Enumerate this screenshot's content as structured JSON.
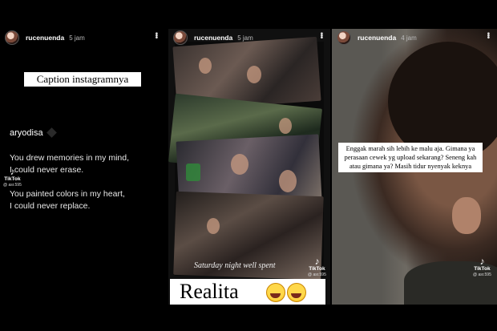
{
  "stories": [
    {
      "username": "rucenuenda",
      "time": "5 jam",
      "caption_box": "Caption instagramnya",
      "song_user": "aryodisa",
      "lines": [
        "You drew memories in my mind,",
        "I could never erase.",
        "You painted colors in my heart,",
        "I could never replace."
      ],
      "watermark": {
        "brand": "TikTok",
        "handle": "@ asr.595"
      }
    },
    {
      "username": "rucenuenda",
      "time": "5 jam",
      "photo_caption": "Saturday night well spent",
      "overlay_text": "Realita",
      "emoji_icons": [
        "rofl-emoji-icon",
        "rofl-emoji-icon"
      ],
      "watermark": {
        "brand": "TikTok",
        "handle": "@ asr.595"
      }
    },
    {
      "username": "rucenuenda",
      "time": "4 jam",
      "text_box": "Enggak marah sih lebih ke malu aja. Gimana ya perasaan cewek yg upload sekarang? Seneng kah atau gimana ya? Masih tidur nyenyak keknya",
      "watermark": {
        "brand": "TikTok",
        "handle": "@ asr.595"
      }
    }
  ]
}
